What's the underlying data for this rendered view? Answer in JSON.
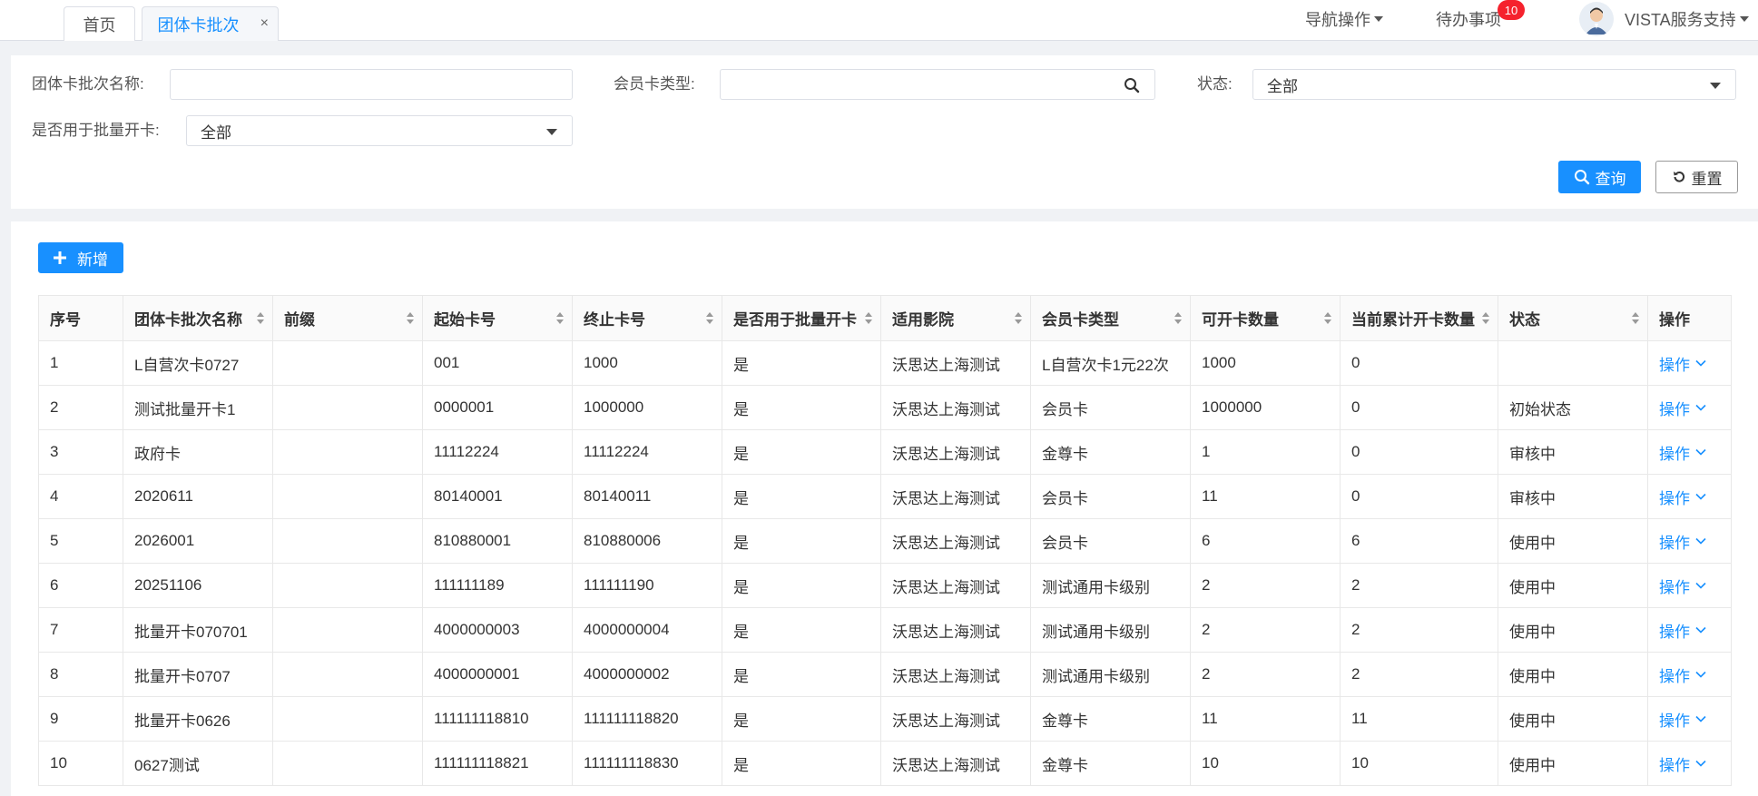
{
  "tabs": [
    {
      "label": "首页"
    },
    {
      "label": "团体卡批次",
      "close": "×"
    }
  ],
  "topnav": {
    "nav_ops": "导航操作",
    "todo": "待办事项",
    "todo_count": "10",
    "user": "VISTA服务支持"
  },
  "filters": {
    "batch_name_label": "团体卡批次名称:",
    "batch_name_value": "",
    "card_type_label": "会员卡类型:",
    "card_type_value": "",
    "status_label": "状态:",
    "status_value": "全部",
    "batch_open_label": "是否用于批量开卡:",
    "batch_open_value": "全部",
    "query": "查询",
    "reset": "重置"
  },
  "toolbar": {
    "add": "新增"
  },
  "table": {
    "headers": [
      "序号",
      "团体卡批次名称",
      "前缀",
      "起始卡号",
      "终止卡号",
      "是否用于批量开卡",
      "适用影院",
      "会员卡类型",
      "可开卡数量",
      "当前累计开卡数量",
      "状态",
      "操作"
    ],
    "rows": [
      {
        "c": [
          "1",
          "L自营次卡0727",
          "",
          "001",
          "1000",
          "是",
          "沃思达上海测试",
          "L自营次卡1元22次",
          "1000",
          "0",
          "",
          "操作"
        ]
      },
      {
        "c": [
          "2",
          "测试批量开卡1",
          "",
          "0000001",
          "1000000",
          "是",
          "沃思达上海测试",
          "会员卡",
          "1000000",
          "0",
          "初始状态",
          "操作"
        ]
      },
      {
        "c": [
          "3",
          "政府卡",
          "",
          "11112224",
          "11112224",
          "是",
          "沃思达上海测试",
          "金尊卡",
          "1",
          "0",
          "审核中",
          "操作"
        ]
      },
      {
        "c": [
          "4",
          "2020611",
          "",
          "80140001",
          "80140011",
          "是",
          "沃思达上海测试",
          "会员卡",
          "11",
          "0",
          "审核中",
          "操作"
        ]
      },
      {
        "c": [
          "5",
          "2026001",
          "",
          "810880001",
          "810880006",
          "是",
          "沃思达上海测试",
          "会员卡",
          "6",
          "6",
          "使用中",
          "操作"
        ]
      },
      {
        "c": [
          "6",
          "20251106",
          "",
          "111111189",
          "111111190",
          "是",
          "沃思达上海测试",
          "测试通用卡级别",
          "2",
          "2",
          "使用中",
          "操作"
        ]
      },
      {
        "c": [
          "7",
          "批量开卡070701",
          "",
          "4000000003",
          "4000000004",
          "是",
          "沃思达上海测试",
          "测试通用卡级别",
          "2",
          "2",
          "使用中",
          "操作"
        ]
      },
      {
        "c": [
          "8",
          "批量开卡0707",
          "",
          "4000000001",
          "4000000002",
          "是",
          "沃思达上海测试",
          "测试通用卡级别",
          "2",
          "2",
          "使用中",
          "操作"
        ]
      },
      {
        "c": [
          "9",
          "批量开卡0626",
          "",
          "111111118810",
          "111111118820",
          "是",
          "沃思达上海测试",
          "金尊卡",
          "11",
          "11",
          "使用中",
          "操作"
        ]
      },
      {
        "c": [
          "10",
          "0627测试",
          "",
          "111111118821",
          "111111118830",
          "是",
          "沃思达上海测试",
          "金尊卡",
          "10",
          "10",
          "使用中",
          "操作"
        ]
      }
    ]
  },
  "colors": {
    "primary": "#1890ff",
    "badge": "#f5222d"
  }
}
